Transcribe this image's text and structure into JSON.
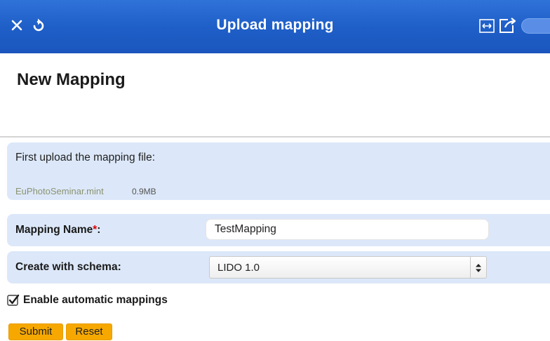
{
  "titlebar": {
    "title": "Upload mapping",
    "icons": [
      "close-icon",
      "reload-icon",
      "expand-icon",
      "export-icon",
      "toggle-switch"
    ],
    "background": "#1f5fc8"
  },
  "page": {
    "heading": "New Mapping"
  },
  "upload": {
    "label": "First upload the mapping file:",
    "file_name": "EuPhotoSeminar.mint",
    "file_size": "0.9MB"
  },
  "mapping_name": {
    "label": "Mapping Name",
    "required_mark": "*",
    "colon": ":",
    "value": "TestMapping"
  },
  "schema": {
    "label": "Create with schema:",
    "selected": "LIDO 1.0"
  },
  "auto_mappings": {
    "label": "Enable automatic mappings",
    "checked": true
  },
  "buttons": {
    "submit": "Submit",
    "reset": "Reset",
    "color": "#f7a800"
  },
  "colors": {
    "panel": "#dce8f9",
    "required": "#dd0000"
  }
}
